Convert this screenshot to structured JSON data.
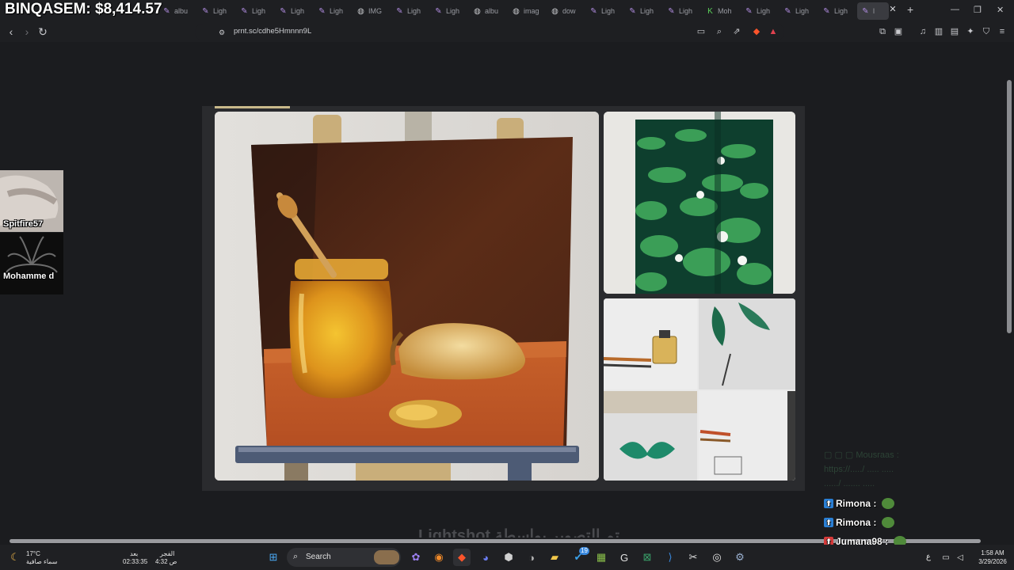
{
  "stream_overlay": {
    "earnings_label": "BINQASEM: $8,414.57",
    "cams": [
      {
        "name": "Spitfire57"
      },
      {
        "name": "Mohamme d"
      }
    ],
    "chat_faded": [
      "▢ ▢ ▢ Mousraas :",
      "https://...../ ..... .....",
      "....../ ....... ....."
    ],
    "chat": [
      {
        "user": "Rimona :",
        "badge_color": "#2a7fd4"
      },
      {
        "user": "Rimona :",
        "badge_color": "#2a7fd4"
      },
      {
        "user": "Jumana98 :",
        "badge_color": "#d63a3a"
      },
      {
        "user": "Jumana98 :",
        "badge_color": "#d63a3a"
      }
    ]
  },
  "browser": {
    "tabs": [
      {
        "icon": "pen-icon",
        "label": "albu"
      },
      {
        "icon": "pen-icon",
        "label": "Ligh"
      },
      {
        "icon": "pen-icon",
        "label": "Ligh"
      },
      {
        "icon": "pen-icon",
        "label": "Ligh"
      },
      {
        "icon": "pen-icon",
        "label": "Ligh"
      },
      {
        "icon": "globe-icon",
        "label": "IMG"
      },
      {
        "icon": "pen-icon",
        "label": "Ligh"
      },
      {
        "icon": "pen-icon",
        "label": "Ligh"
      },
      {
        "icon": "globe-icon",
        "label": "albu"
      },
      {
        "icon": "globe-icon",
        "label": "imag"
      },
      {
        "icon": "globe-icon",
        "label": "dow"
      },
      {
        "icon": "pen-icon",
        "label": "Ligh"
      },
      {
        "icon": "pen-icon",
        "label": "Ligh"
      },
      {
        "icon": "pen-icon",
        "label": "Ligh"
      },
      {
        "icon": "k-icon",
        "label": "Moh"
      },
      {
        "icon": "pen-icon",
        "label": "Ligh"
      },
      {
        "icon": "pen-icon",
        "label": "Ligh"
      },
      {
        "icon": "pen-icon",
        "label": "Ligh"
      },
      {
        "icon": "pen-icon",
        "label": "l"
      }
    ],
    "address": "prnt.sc/cdhe5Hmnnn9L",
    "brand_color": "#1e1f22"
  },
  "page": {
    "bottom_caption": "تم التصوير بواسطة Lightshot"
  },
  "taskbar": {
    "weather_temp": "17°C",
    "weather_desc": "سماء صافية",
    "prayer_label_1": "بعد",
    "prayer_time_1": "02:33:35",
    "prayer_label_2": "الفجر",
    "prayer_time_2": "4:32 ص",
    "search_label": "Search",
    "lang": "ع",
    "time": "1:58 AM",
    "date": "3/29/2026",
    "badge_count": "19"
  }
}
